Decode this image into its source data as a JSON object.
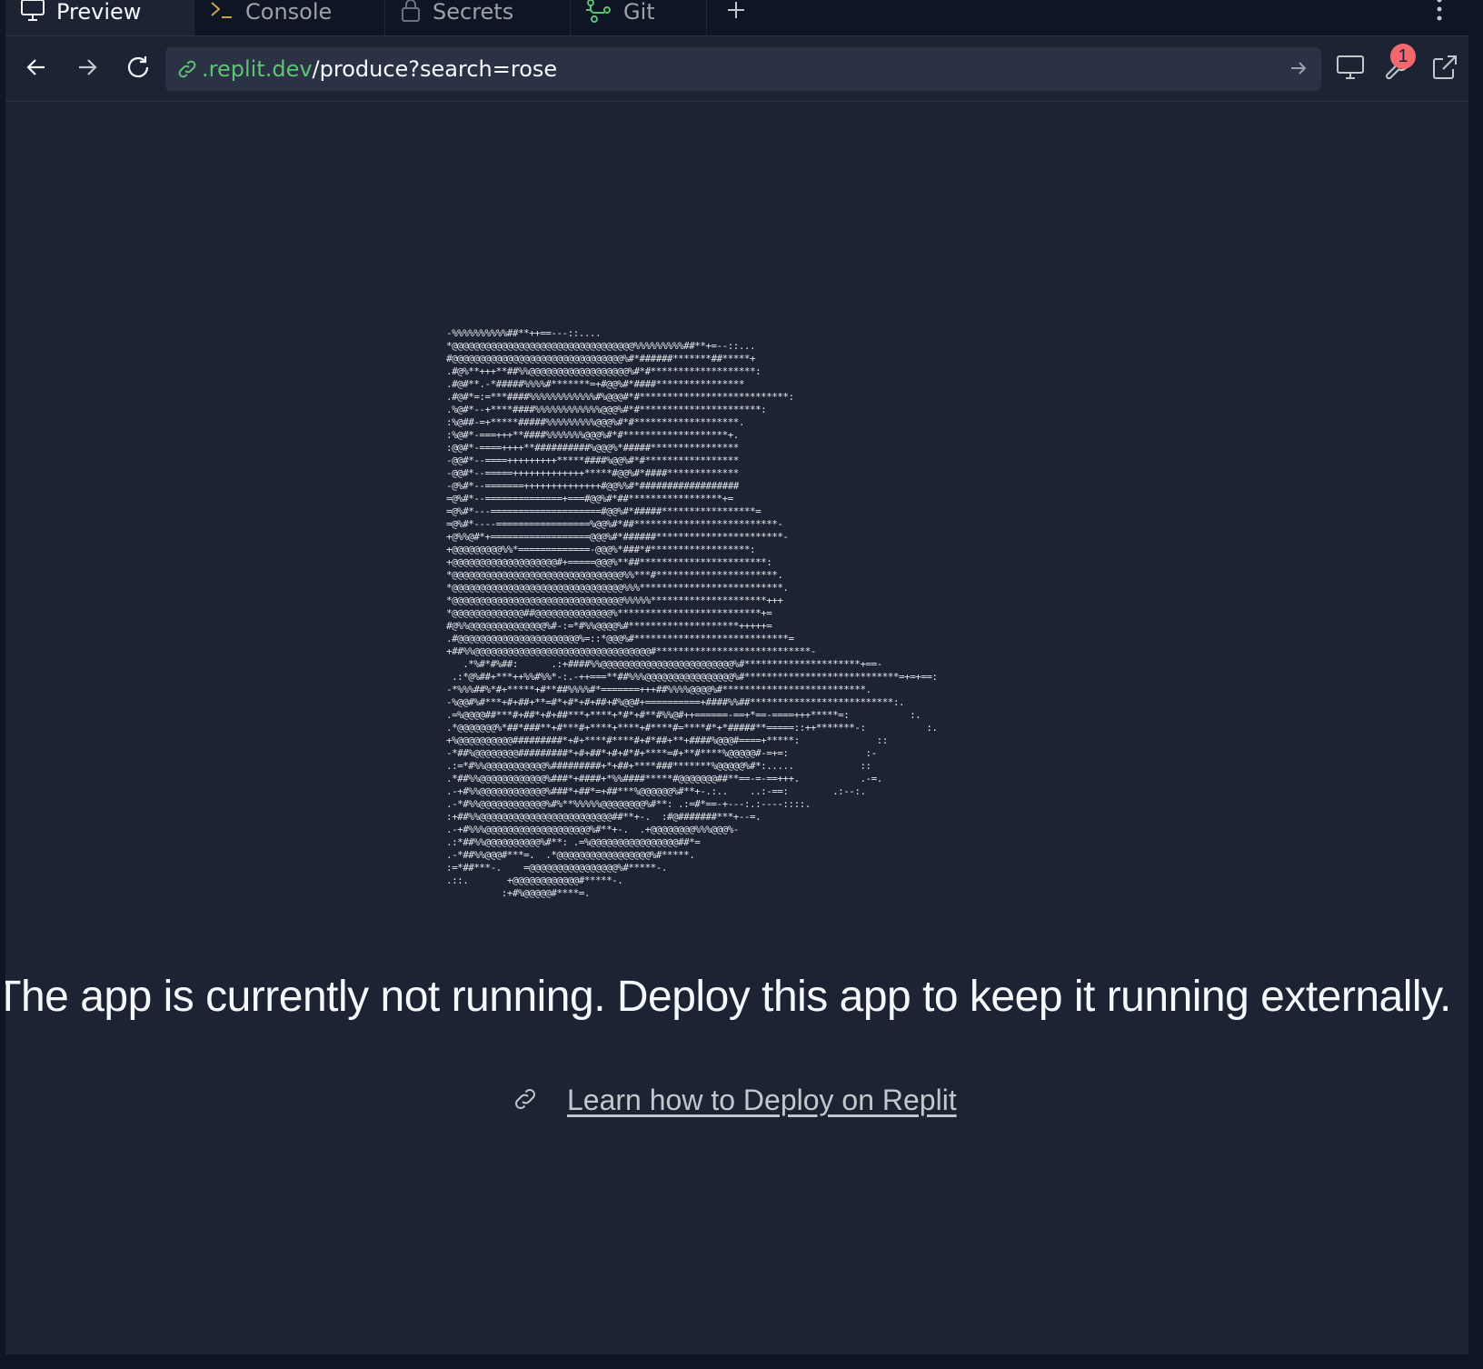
{
  "tabs": [
    {
      "label": "Preview",
      "icon": "monitor-icon",
      "active": true
    },
    {
      "label": "Console",
      "icon": "terminal-icon",
      "active": false
    },
    {
      "label": "Secrets",
      "icon": "lock-icon",
      "active": false
    },
    {
      "label": "Git",
      "icon": "git-branch-icon",
      "active": false
    }
  ],
  "address_bar": {
    "host": ".replit.dev",
    "path": "/produce?search=rose"
  },
  "toolbar": {
    "devtools_badge_count": "1"
  },
  "content": {
    "ascii_art": "-%%%%%%%%%%##**++==---::....\n*@@@@@@@@@@@@@@@@@@@@@@@@@@@@@@@@@%%%%%%%%%##**+=--::...\n#@@@@@@@@@@@@@@@@@@@@@@@@@@@@@@@%#*######*******##*****+\n.#@%**+++**##%%@@@@@@@@@@@@@@@@@@%#*#*******************:\n.#@#**.-*#####%%%%#*******=+#@@%#*####****************\n.#@#*=:=***####%%%%%%%%%%%%#%@@@#*#***************************:\n.%@#*--+****####%%%%%%%%%%%%@@@%#*#**********************:\n:%@##-=+*****#####%%%%%%%%%@@@%#*#*******************.\n:%@#*-===+++**####%%%%%%%@@@%#*#*******************+.\n:@@#*-====++++**##########%@@@%*#####****************\n-@@#*--====+++++++++*****####%@@%#*#*****************\n-@@#*--=====+++++++++++++*****#@@%#*####*************\n-@%#*--=======++++++++++++++#@@%%#*##################\n=@%#*--==============+===#@@%#*##*****************+=\n=@%#*---====================#@@%#*#####*****************=\n=@%#*----=================%@@%#*##**************************-\n+@%%@#*+==================@@@%#*######***********************-\n+@@@@@@@@@%%*=============-@@@%*###*#******************:\n+@@@@@@@@@@@@@@@@@@@#+=====@@@%**##***********************:\n*@@@@@@@@@@@@@@@@@@@@@@@@@@@@@@@%%***#**********************.\n*@@@@@@@@@@@@@@@@@@@@@@@@@@@@@@@%%%**************************.\n*@@@@@@@@@@@@@@@@@@@@@@@@@@@@@@@%%%%%*********************+++\n*@@@@@@@@@@@@@##@@@@@@@@@@@@@@%**************************+=\n#@%%@@@@@@@@@@@@@@%#-:=*#%%@@@@%#********************+++++=\n.#@@@@@@@@@@@@@@@@@@@@@@%=::*@@@%#****************************=\n+##%%@@@@@@@@@@@@@@@@@@@@@@@@@@@@@@@@#****************************-\n   .*%#*#%##:      .:+####%%@@@@@@@@@@@@@@@@@@@@@@@@%#*********************+==-\n .:*@%##+***++%%#%%*-:.-++===**##%%%@@@@@@@@@@@@@@@@%#****************************=+=+==:\n-*%%%##%*#+*****+#**##%%%%#*=======+++##%%%%@@@@%#**************************.\n-%@@#%#***+#+##+**=#*+#*+#+##+#%@@#+==========+####%%##**************************:.\n.=%@@@@##***#+##*+#+##***+****+*#*+#**#%%@#++======-==+*==-====+++*****=:           :.\n.*@@@@@@@%*##*###**+#***#+****+****+#****#=****#*+*#####**=====::++*******-:           :.\n+%@@@@@@@@@@#########*+#+****#****#+#*##+**+####%@@@#====+*****:              ::\n-*##%@@@@@@@@#########*+#+##*+#+#*#+****=#+**#****%@@@@@#-=+=:              :-\n.:=*#%%@@@@@@@@@@@%#########+*+##+****###*******%@@@@@%#*:.....            ::\n.*##%%@@@@@@@@@@@@%###*+####+*%%####*****#@@@@@@@##**==-=-==+++.           .-=.\n.-+#%%@@@@@@@@@@@@%###*+##*=+##***%@@@@@@%#**+-.:..    ..:-==:        .:--:.\n.-*#%%@@@@@@@@@@@@%#%**%%%%%@@@@@@@@%#**: .:=#*==-+---:.:----::::.\n:+##%%@@@@@@@@@@@@@@@@@@@@@@@@##**+-.  :#@#######***+--=.\n.-+#%%%@@@@@@@@@@@@@@@@@@@%#**+-.  .+@@@@@@@@%%%@@@%-\n.:*##%%@@@@@@@@@@%#**: .=%@@@@@@@@@@@@@@@@##*=\n.-*##%%@@@#***=.  .*@@@@@@@@@@@@@@@@@%#*****.\n:=*##***-.    =@@@@@@@@@@@@@@@@%#*****-.\n.::.       +@@@@@@@@@@@@#*****-.\n          :+#%@@@@@#****=.",
    "message": "The app is currently not running. Deploy this app to keep it running externally.",
    "link_text": "Learn how to Deploy on Replit"
  },
  "colors": {
    "background": "#1c2333",
    "chrome": "#0e1525",
    "url_field": "#2b3245",
    "host_green": "#5cc375",
    "badge_red": "#f2686d"
  }
}
